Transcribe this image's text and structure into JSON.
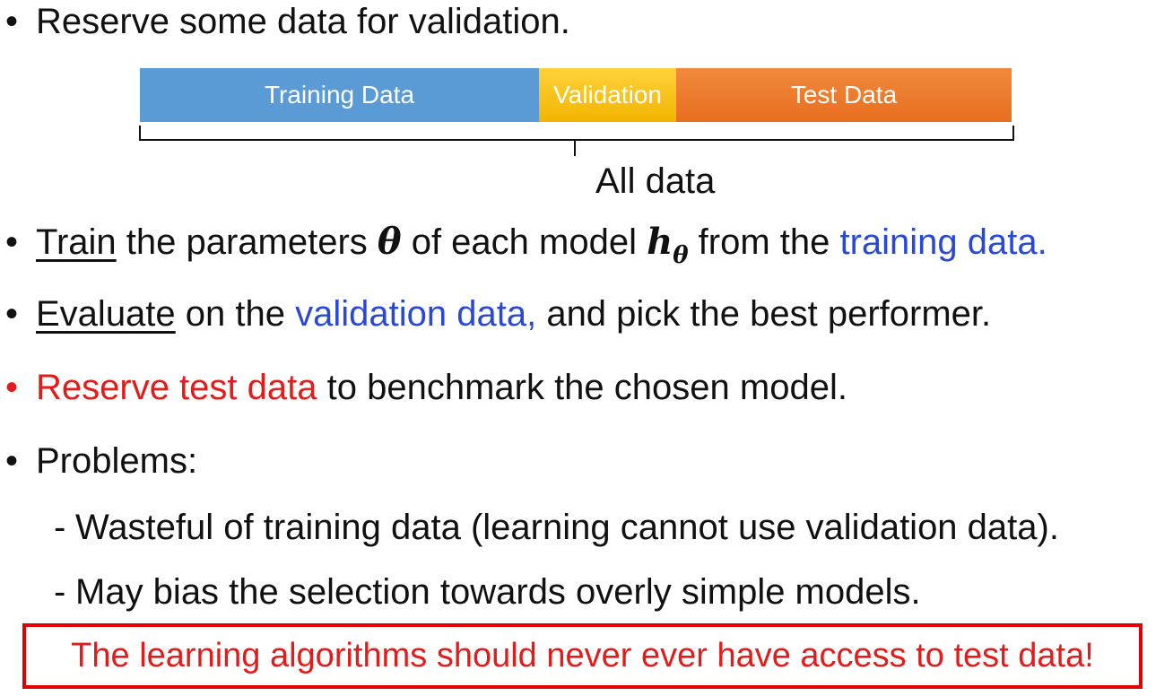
{
  "bullet_char": "•",
  "dash_char": "-",
  "intro": {
    "text": "Reserve some data for validation."
  },
  "split_bar": {
    "segments": [
      {
        "label": "Training Data",
        "color": "#5b9bd5"
      },
      {
        "label": "Validation",
        "color": "#f5b800"
      },
      {
        "label": "Test Data",
        "color": "#ec7424"
      }
    ],
    "all_label": "All data"
  },
  "train_line": {
    "keyword": "Train",
    "text1": " the parameters ",
    "theta": "θ",
    "text2": " of each model ",
    "h": "h",
    "h_sub": "θ",
    "text3": " from the ",
    "highlight": "training data."
  },
  "eval_line": {
    "keyword": "Evaluate",
    "text1": " on the ",
    "highlight": "validation data,",
    "text2": " and pick the best performer."
  },
  "reserve_line": {
    "highlight": "Reserve test data",
    "text": " to benchmark the chosen model."
  },
  "problems": {
    "heading": "Problems:",
    "items": [
      "Wasteful of training data (learning cannot use validation data).",
      "May bias the selection towards overly simple models."
    ]
  },
  "warning": "The learning algorithms should never ever have access to test data!",
  "colors": {
    "highlight_blue": "#2a48d6",
    "highlight_red": "#e31b1b",
    "box_border": "#e00000"
  }
}
